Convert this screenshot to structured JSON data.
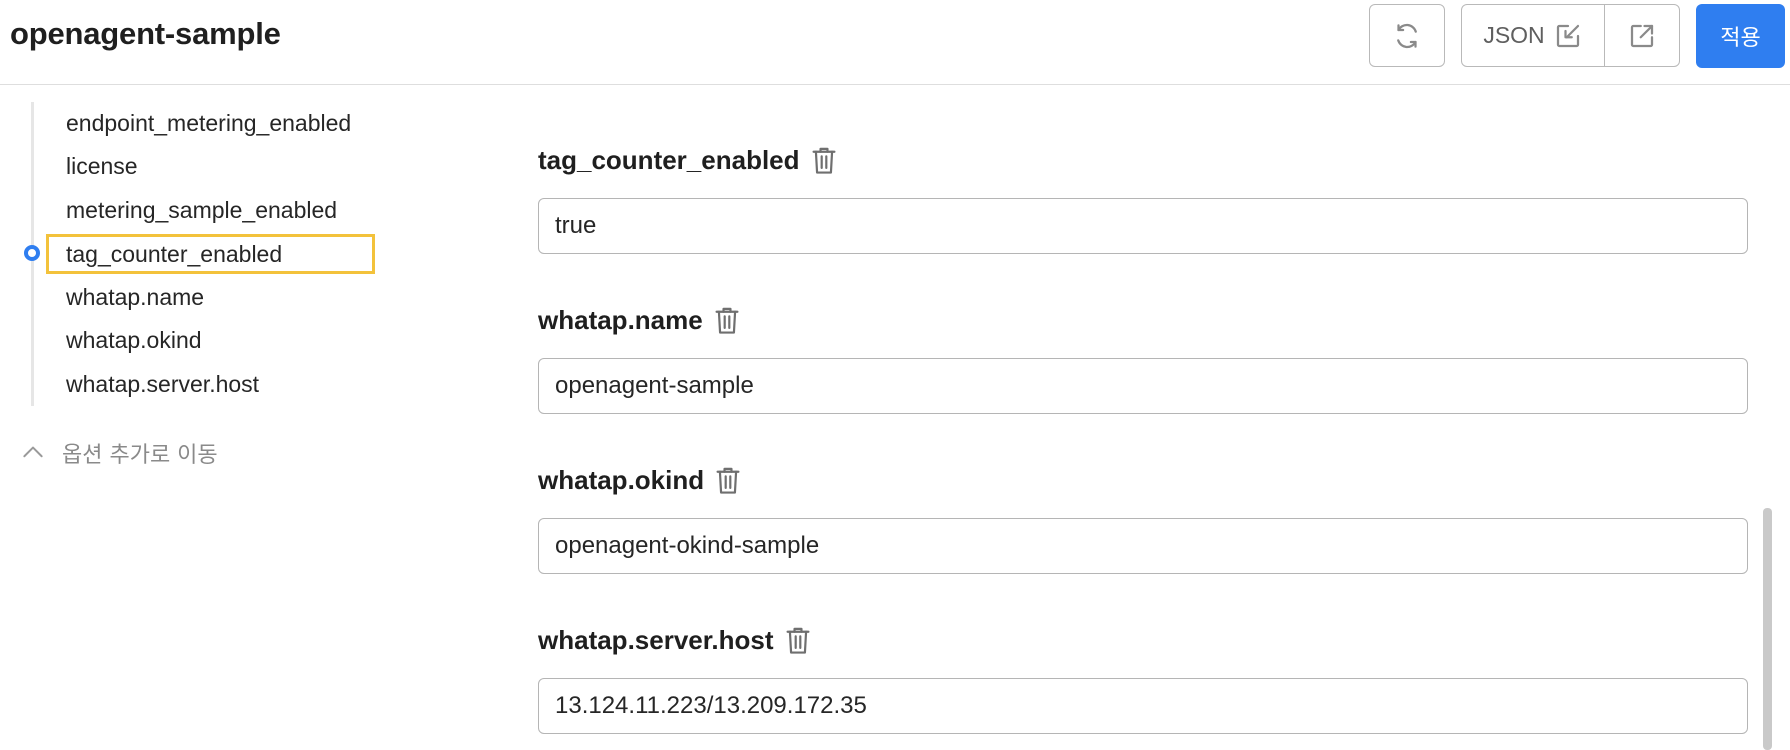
{
  "header": {
    "title": "openagent-sample",
    "json_label": "JSON",
    "apply_label": "적용"
  },
  "nav": {
    "items": [
      {
        "label": "endpoint_metering_enabled"
      },
      {
        "label": "license"
      },
      {
        "label": "metering_sample_enabled"
      },
      {
        "label": "tag_counter_enabled"
      },
      {
        "label": "whatap.name"
      },
      {
        "label": "whatap.okind"
      },
      {
        "label": "whatap.server.host"
      }
    ],
    "active_index": 3,
    "goto_add_label": "옵션 추가로 이동"
  },
  "fields": [
    {
      "label": "tag_counter_enabled",
      "value": "true"
    },
    {
      "label": "whatap.name",
      "value": "openagent-sample"
    },
    {
      "label": "whatap.okind",
      "value": "openagent-okind-sample"
    },
    {
      "label": "whatap.server.host",
      "value": "13.124.11.223/13.209.172.35"
    }
  ],
  "colors": {
    "accent": "#2f7ef0",
    "highlight": "#f3c23b"
  }
}
